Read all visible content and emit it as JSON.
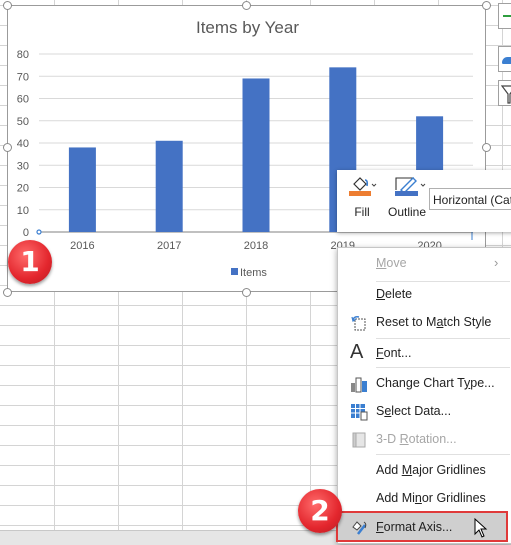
{
  "chart_data": {
    "type": "bar",
    "title": "Items by Year",
    "categories": [
      "2016",
      "2017",
      "2018",
      "2019",
      "2020"
    ],
    "series": [
      {
        "name": "Items",
        "values": [
          38,
          41,
          69,
          74,
          52
        ],
        "color": "#4472c4"
      }
    ],
    "xlabel": "",
    "ylabel": "",
    "ylim": [
      0,
      80
    ],
    "yticks": [
      0,
      10,
      20,
      30,
      40,
      50,
      60,
      70,
      80
    ],
    "grid": true,
    "legend": "bottom"
  },
  "mini_toolbar": {
    "fill_label": "Fill",
    "outline_label": "Outline",
    "fill_color": "#ed7d31",
    "outline_color": "#4472c4",
    "element_selector_value": "Horizontal (Cat"
  },
  "context_menu": {
    "items": [
      {
        "label": "Move",
        "underline": "M",
        "disabled": true,
        "submenu": true,
        "icon": ""
      },
      {
        "label": "Delete",
        "underline": "D",
        "disabled": false,
        "icon": ""
      },
      {
        "label": "Reset to Match Style",
        "underline": "a",
        "disabled": false,
        "icon": "reset-style-icon"
      },
      {
        "label": "Font...",
        "underline": "F",
        "disabled": false,
        "icon": "font-icon"
      },
      {
        "label": "Change Chart Type...",
        "underline": "Y",
        "disabled": false,
        "icon": "chart-type-icon"
      },
      {
        "label": "Select Data...",
        "underline": "e",
        "disabled": false,
        "icon": "select-data-icon"
      },
      {
        "label": "3-D Rotation...",
        "underline": "R",
        "disabled": true,
        "icon": "3d-rotation-icon"
      },
      {
        "label": "Add Major Gridlines",
        "underline": "M",
        "disabled": false,
        "icon": ""
      },
      {
        "label": "Add Minor Gridlines",
        "underline": "n",
        "disabled": false,
        "icon": ""
      },
      {
        "label": "Format Axis...",
        "underline": "F",
        "disabled": false,
        "highlighted": true,
        "icon": "format-axis-icon"
      }
    ]
  },
  "annotations": {
    "step1": "1",
    "step2": "2"
  },
  "colors": {
    "bar": "#4472c4",
    "badge": "#e3262d",
    "highlight_border": "#e03a3a"
  }
}
